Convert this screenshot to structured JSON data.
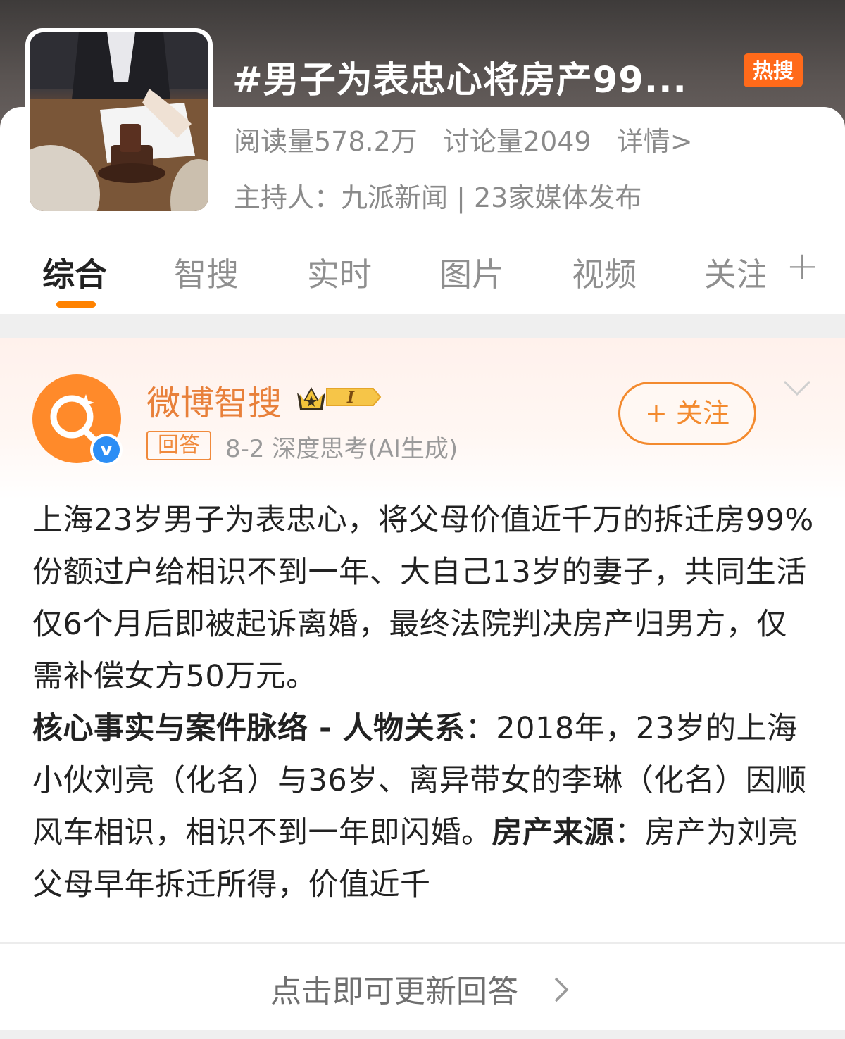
{
  "topic": {
    "title": "#男子为表忠心将房产99...",
    "hot_badge": "热搜",
    "reads": "阅读量578.2万",
    "discussions": "讨论量2049",
    "details_link": "详情>",
    "host": "主持人：九派新闻 | 23家媒体发布",
    "thumbnail_icon": "courtroom-gavel-photo"
  },
  "tabs": {
    "items": [
      "综合",
      "智搜",
      "实时",
      "图片",
      "视频"
    ],
    "clipped": "关注",
    "active_index": 0,
    "plus_icon": "plus-icon"
  },
  "post": {
    "author": "微博智搜",
    "level_badge": "I",
    "reply_tag": "回答",
    "meta": "8-2  深度思考(AI生成)",
    "follow_label": "+ 关注",
    "paragraph1": "上海23岁男子为表忠心，将父母价值近千万的拆迁房99%份额过户给相识不到一年、大自己13岁的妻子，共同生活仅6个月后即被起诉离婚，最终法院判决房产归男方，仅需补偿女方50万元。",
    "section1_title": "核心事实与案件脉络 - 人物关系",
    "section1_text": "：2018年，23岁的上海小伙刘亮（化名）与36岁、离异带女的李琳（化名）因顺风车相识，相识不到一年即闪婚。",
    "section2_title": "房产来源",
    "section2_text": "：房产为刘亮父母早年拆迁所得，价值近千"
  },
  "refresh": {
    "label": "点击即可更新回答"
  },
  "colors": {
    "accent": "#ff8200",
    "hot": "#ff6a1a",
    "author": "#e8803a",
    "verify": "#2c8ef5"
  }
}
